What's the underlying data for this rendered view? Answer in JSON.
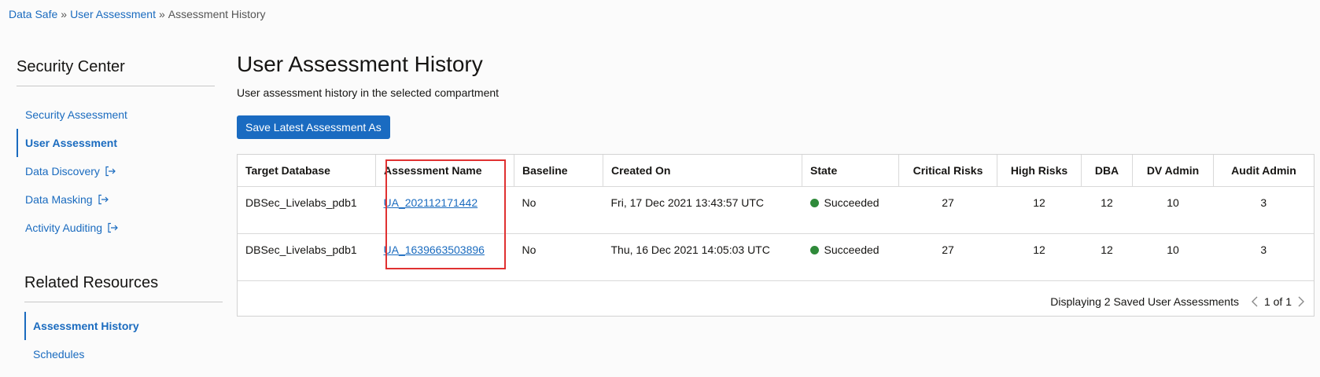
{
  "breadcrumb": {
    "items": [
      "Data Safe",
      "User Assessment"
    ],
    "current": "Assessment History",
    "separator": "»"
  },
  "sidebar": {
    "heading": "Security Center",
    "items": [
      {
        "label": "Security Assessment",
        "external": false
      },
      {
        "label": "User Assessment",
        "external": false,
        "active": true
      },
      {
        "label": "Data Discovery",
        "external": true
      },
      {
        "label": "Data Masking",
        "external": true
      },
      {
        "label": "Activity Auditing",
        "external": true
      }
    ]
  },
  "related": {
    "heading": "Related Resources",
    "items": [
      {
        "label": "Assessment History",
        "active": true
      },
      {
        "label": "Schedules"
      }
    ]
  },
  "main": {
    "title": "User Assessment History",
    "description": "User assessment history in the selected compartment",
    "save_button": "Save Latest Assessment As"
  },
  "table": {
    "columns": [
      "Target Database",
      "Assessment Name",
      "Baseline",
      "Created On",
      "State",
      "Critical Risks",
      "High Risks",
      "DBA",
      "DV Admin",
      "Audit Admin"
    ],
    "rows": [
      {
        "target": "DBSec_Livelabs_pdb1",
        "name": "UA_202112171442",
        "baseline": "No",
        "created": "Fri, 17 Dec 2021 13:43:57 UTC",
        "state": "Succeeded",
        "critical": "27",
        "high": "12",
        "dba": "12",
        "dv_admin": "10",
        "audit_admin": "3"
      },
      {
        "target": "DBSec_Livelabs_pdb1",
        "name": "UA_1639663503896",
        "baseline": "No",
        "created": "Thu, 16 Dec 2021 14:05:03 UTC",
        "state": "Succeeded",
        "critical": "27",
        "high": "12",
        "dba": "12",
        "dv_admin": "10",
        "audit_admin": "3"
      }
    ],
    "footer": "Displaying 2 Saved User Assessments",
    "page": "1 of 1"
  },
  "colors": {
    "accent": "#1a6bbf",
    "success": "#2f8a3a",
    "highlight": "#e03131"
  }
}
